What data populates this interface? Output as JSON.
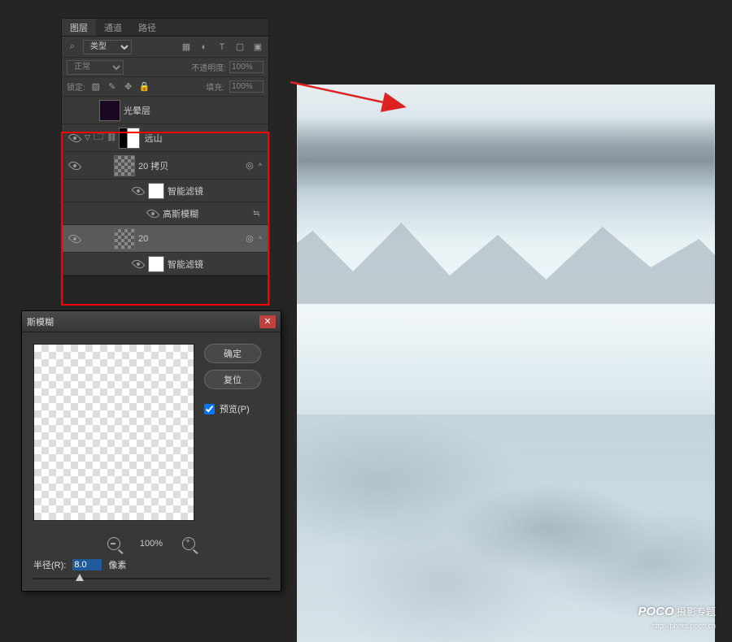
{
  "panel": {
    "tabs": [
      "图层",
      "通道",
      "路径"
    ],
    "filter_kind": "类型",
    "blend_mode": "正常",
    "opacity_label": "不透明度:",
    "opacity_value": "100%",
    "lock_label": "锁定:",
    "fill_label": "填充:",
    "fill_value": "100%"
  },
  "layers": {
    "glow": "光晕层",
    "group": "远山",
    "copy20": "20 拷贝",
    "smart_filter1": "智能滤镜",
    "gauss": "高斯模糊",
    "l20": "20",
    "smart_filter2": "智能滤镜"
  },
  "dialog": {
    "title": "斯模糊",
    "ok": "确定",
    "reset": "复位",
    "preview": "预览(P)",
    "zoom": "100%",
    "radius_label": "半径(R):",
    "radius_value": "8.0",
    "radius_unit": "像素"
  },
  "watermark": {
    "brand": "POCO",
    "topic": "摄影专题",
    "url": "http://photo.poco.cn"
  }
}
